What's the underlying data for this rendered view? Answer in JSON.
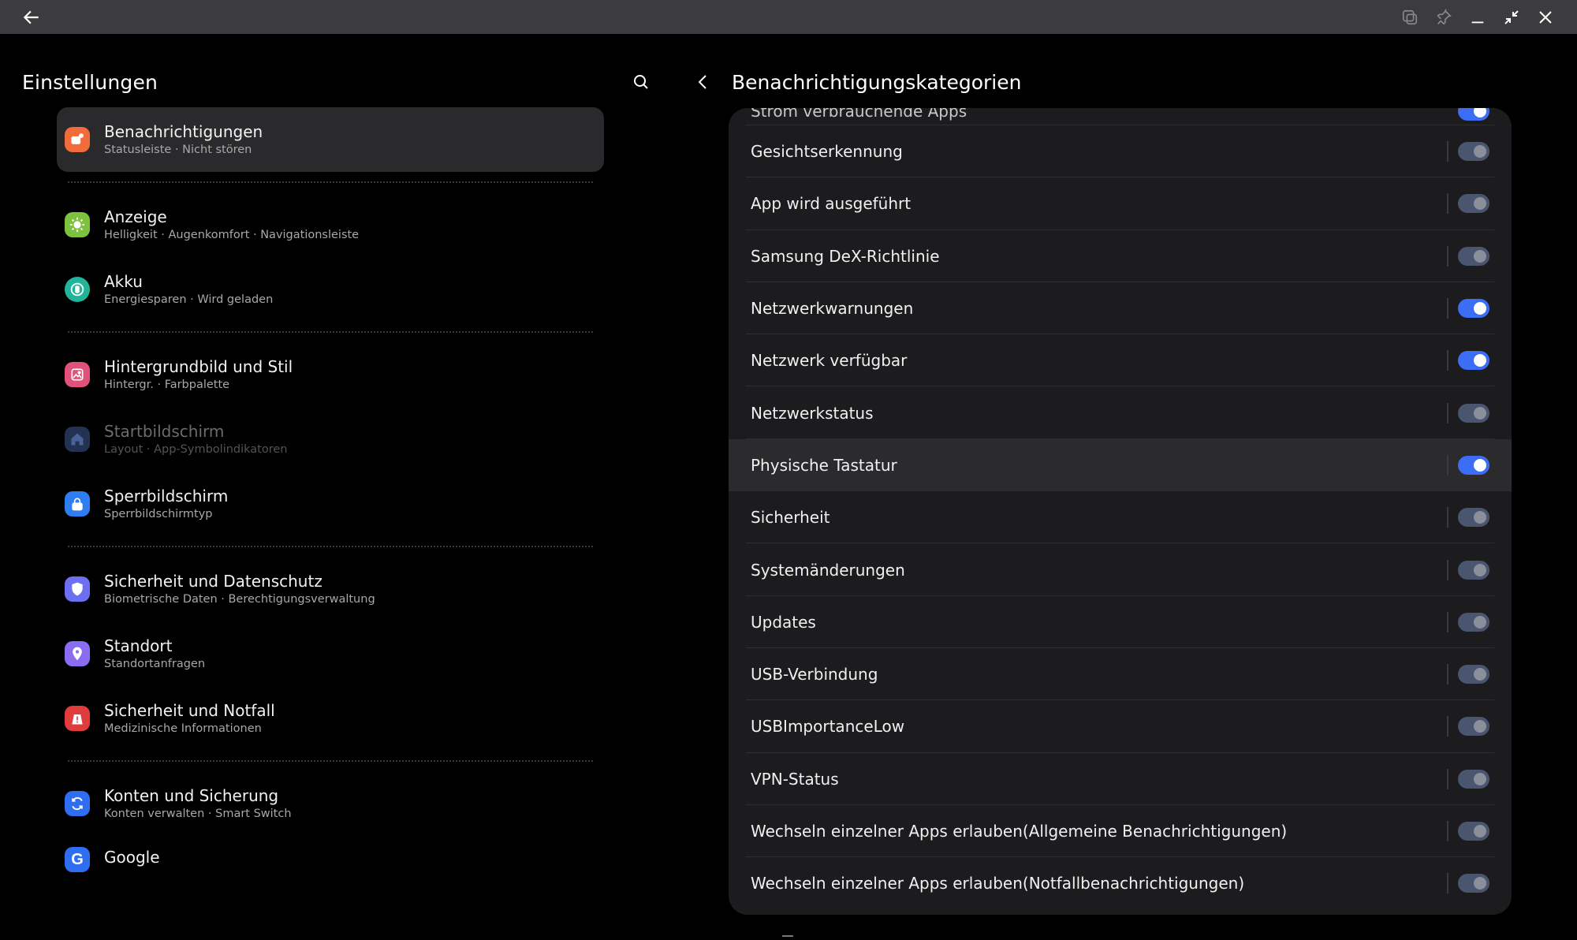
{
  "titlebar": {
    "back_icon": "arrow-left-icon",
    "actions": [
      "popup-view-icon",
      "pin-icon",
      "minimize-icon",
      "exit-fullscreen-icon",
      "close-icon"
    ]
  },
  "left": {
    "title": "Einstellungen",
    "items": [
      {
        "title": "Benachrichtigungen",
        "subtitle": "Statusleiste  ·  Nicht stören",
        "icon": "notification-icon",
        "color": "#f26b3a",
        "selected": true
      },
      {
        "title": "Anzeige",
        "subtitle": "Helligkeit  ·  Augenkomfort  ·  Navigationsleiste",
        "icon": "sun-icon",
        "color": "#7cc23e"
      },
      {
        "title": "Akku",
        "subtitle": "Energiesparen  ·  Wird geladen",
        "icon": "battery-icon",
        "color": "#1fb59a"
      },
      {
        "title": "Hintergrundbild und Stil",
        "subtitle": "Hintergr.  ·  Farbpalette",
        "icon": "wallpaper-icon",
        "color": "#e0527a"
      },
      {
        "title": "Startbildschirm",
        "subtitle": "Layout  ·  App-Symbolindikatoren",
        "icon": "home-icon",
        "color": "#3a4f7a",
        "disabled": true
      },
      {
        "title": "Sperrbildschirm",
        "subtitle": "Sperrbildschirmtyp",
        "icon": "lock-icon",
        "color": "#2f7df2"
      },
      {
        "title": "Sicherheit und Datenschutz",
        "subtitle": "Biometrische Daten  ·  Berechtigungsverwaltung",
        "icon": "shield-icon",
        "color": "#6d6ff2"
      },
      {
        "title": "Standort",
        "subtitle": "Standortanfragen",
        "icon": "location-pin-icon",
        "color": "#8c6cf2"
      },
      {
        "title": "Sicherheit und Notfall",
        "subtitle": "Medizinische Informationen",
        "icon": "emergency-icon",
        "color": "#e03c3c"
      },
      {
        "title": "Konten und Sicherung",
        "subtitle": "Konten verwalten  ·  Smart Switch",
        "icon": "sync-icon",
        "color": "#2f6df2"
      },
      {
        "title": "Google",
        "subtitle": "",
        "icon": "google-icon",
        "color": "#2f6df2"
      }
    ]
  },
  "right": {
    "title": "Benachrichtigungskategorien",
    "cut_item": "Strom verbrauchende Apps",
    "rows": [
      {
        "label": "Gesichtserkennung",
        "on": false
      },
      {
        "label": "App wird ausgeführt",
        "on": false
      },
      {
        "label": "Samsung DeX-Richtlinie",
        "on": false
      },
      {
        "label": "Netzwerkwarnungen",
        "on": true
      },
      {
        "label": "Netzwerk verfügbar",
        "on": true
      },
      {
        "label": "Netzwerkstatus",
        "on": false
      },
      {
        "label": "Physische Tastatur",
        "on": true,
        "highlight": true
      },
      {
        "label": "Sicherheit",
        "on": false
      },
      {
        "label": "Systemänderungen",
        "on": false
      },
      {
        "label": "Updates",
        "on": false
      },
      {
        "label": "USB-Verbindung",
        "on": false
      },
      {
        "label": "USBImportanceLow",
        "on": false
      },
      {
        "label": "VPN-Status",
        "on": false
      },
      {
        "label": "Wechseln einzelner Apps erlauben(Allgemeine Benachrichtigungen)",
        "on": false
      },
      {
        "label": "Wechseln einzelner Apps erlauben(Notfallbenachrichtigungen)",
        "on": false
      }
    ]
  }
}
